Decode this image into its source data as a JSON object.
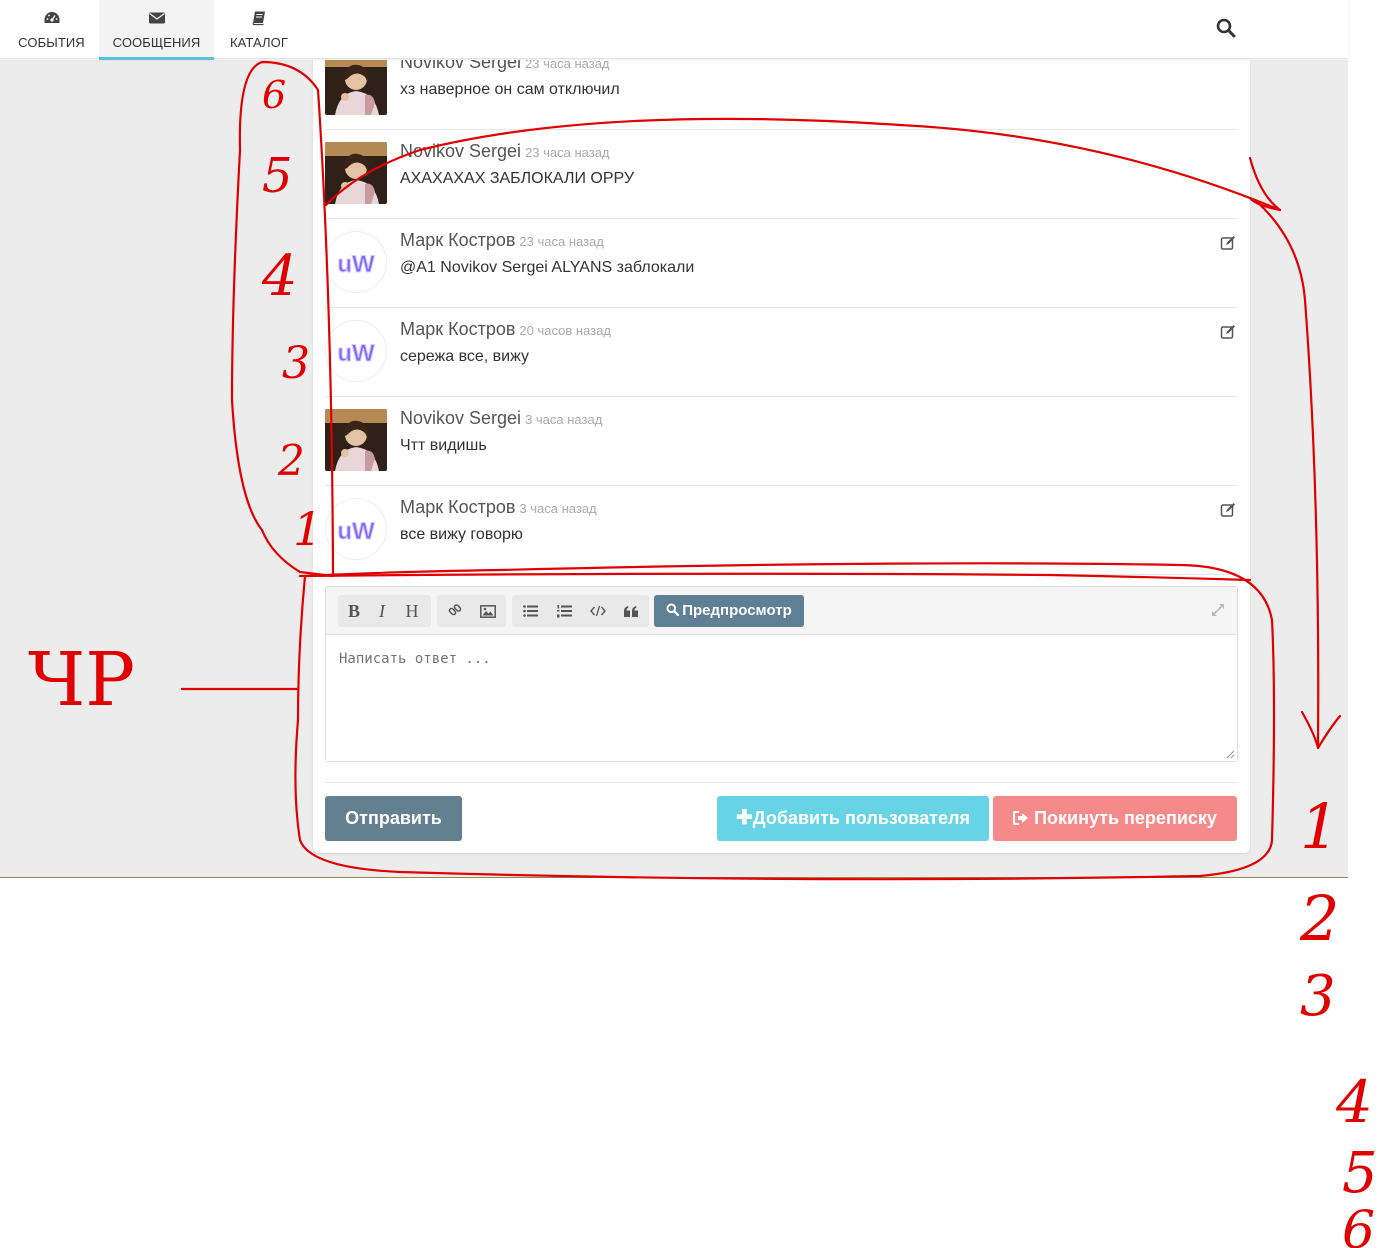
{
  "nav": {
    "tabs": [
      {
        "label": "СОБЫТИЯ",
        "icon": "dashboard-icon"
      },
      {
        "label": "СООБЩЕНИЯ",
        "icon": "envelope-icon",
        "active": true
      },
      {
        "label": "КАТАЛОГ",
        "icon": "book-icon"
      }
    ],
    "search_icon": "search-icon"
  },
  "messages": [
    {
      "author": "Novikov Sergei",
      "time": "23 часа назад",
      "text": "хз наверное он сам отключил",
      "avatar": "photo",
      "editable": false
    },
    {
      "author": "Novikov Sergei",
      "time": "23 часа назад",
      "text": "АХАХАХАХ ЗАБЛОКАЛИ ОРРУ",
      "avatar": "photo",
      "editable": false
    },
    {
      "author": "Марк Костров",
      "time": "23 часа назад",
      "text": "@A1 Novikov Sergei ALYANS заблокали",
      "avatar": "uw",
      "editable": true
    },
    {
      "author": "Марк Костров",
      "time": "20 часов назад",
      "text": "сережа все, вижу",
      "avatar": "uw",
      "editable": true
    },
    {
      "author": "Novikov Sergei",
      "time": "3 часа назад",
      "text": "Чтт видишь",
      "avatar": "photo",
      "editable": false
    },
    {
      "author": "Марк Костров",
      "time": "3 часа назад",
      "text": "все вижу говорю",
      "avatar": "uw",
      "editable": true
    }
  ],
  "avatar_logo_text": "uW",
  "editor": {
    "toolbar": {
      "bold": "B",
      "italic": "I",
      "heading": "H",
      "preview_label": "Предпросмотр"
    },
    "placeholder": "Написать ответ ..."
  },
  "actions": {
    "send_label": "Отправить",
    "add_user_label": "Добавить пользователя",
    "leave_label": "Покинуть переписку"
  },
  "annotations": {
    "left_numbers": [
      "6",
      "5",
      "4",
      "3",
      "2",
      "1"
    ],
    "left_label": "ЧР",
    "right_numbers": [
      "1",
      "2",
      "3",
      "4",
      "5",
      "6"
    ]
  },
  "colors": {
    "active_tab_underline": "#5bc0de",
    "send_button": "#62808f",
    "add_user_button": "#66d4e4",
    "leave_button": "#f58a8a",
    "preview_button": "#5f7f95",
    "annotation": "#e00000"
  }
}
